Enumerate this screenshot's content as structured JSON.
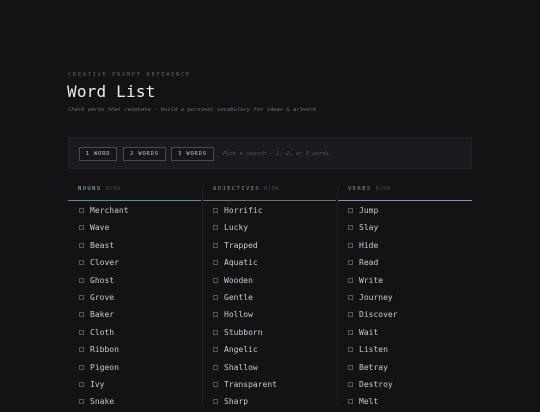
{
  "header": {
    "eyebrow": "CREATIVE PROMPT REFERENCE",
    "title": "Word List",
    "subtitle": "Check words that resonate — build a personal vocabulary for ideas & artwork"
  },
  "toolbar": {
    "buttons": [
      "1 WORD",
      "2 WORDS",
      "3 WORDS"
    ],
    "hint": "Pick a search — 1, 2, or 3 words."
  },
  "columns": [
    {
      "title": "NOUNS",
      "count": "0/96",
      "words": [
        "Merchant",
        "Wave",
        "Beast",
        "Clover",
        "Ghost",
        "Grove",
        "Baker",
        "Cloth",
        "Ribbon",
        "Pigeon",
        "Ivy",
        "Snake"
      ]
    },
    {
      "title": "ADJECTIVES",
      "count": "0/96",
      "words": [
        "Horrific",
        "Lucky",
        "Trapped",
        "Aquatic",
        "Wooden",
        "Gentle",
        "Hollow",
        "Stubborn",
        "Angelic",
        "Shallow",
        "Transparent",
        "Sharp"
      ]
    },
    {
      "title": "VERBS",
      "count": "0/96",
      "words": [
        "Jump",
        "Slay",
        "Hide",
        "Read",
        "Write",
        "Journey",
        "Discover",
        "Wait",
        "Listen",
        "Betray",
        "Destroy",
        "Melt"
      ]
    }
  ]
}
